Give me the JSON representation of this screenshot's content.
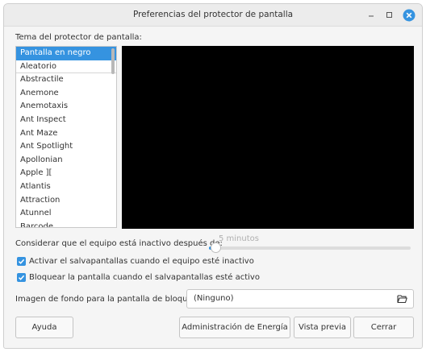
{
  "window": {
    "title": "Preferencias del protector de pantalla"
  },
  "theme_label": "Tema del protector de pantalla:",
  "themes": [
    {
      "label": "Pantalla en negro",
      "selected": true
    },
    {
      "label": "Aleatorio"
    },
    {
      "label": "Abstractile"
    },
    {
      "label": "Anemone"
    },
    {
      "label": "Anemotaxis"
    },
    {
      "label": "Ant Inspect"
    },
    {
      "label": "Ant Maze"
    },
    {
      "label": "Ant Spotlight"
    },
    {
      "label": "Apollonian"
    },
    {
      "label": "Apple ]["
    },
    {
      "label": "Atlantis"
    },
    {
      "label": "Attraction"
    },
    {
      "label": "Atunnel"
    },
    {
      "label": "Barcode"
    }
  ],
  "idle": {
    "label": "Considerar que el equipo está inactivo después de:",
    "value": "5 minutos"
  },
  "checks": {
    "activate_label": "Activar el salvapantallas cuando el equipo esté inactivo",
    "lock_label": "Bloquear la pantalla cuando el salvapantallas esté activo"
  },
  "lock_background": {
    "label": "Imagen de fondo para la pantalla de bloqueo:",
    "value": "(Ninguno)"
  },
  "buttons": {
    "help": "Ayuda",
    "power": "Administración de Energía",
    "preview": "Vista previa",
    "close": "Cerrar"
  },
  "colors": {
    "accent": "#3593e0",
    "close_button": "#3593e0",
    "preview_bg": "#000000"
  },
  "icons": {
    "minimize": "minimize-icon",
    "maximize": "maximize-icon",
    "close": "close-icon",
    "folder": "folder-open-icon",
    "check": "check-icon"
  }
}
